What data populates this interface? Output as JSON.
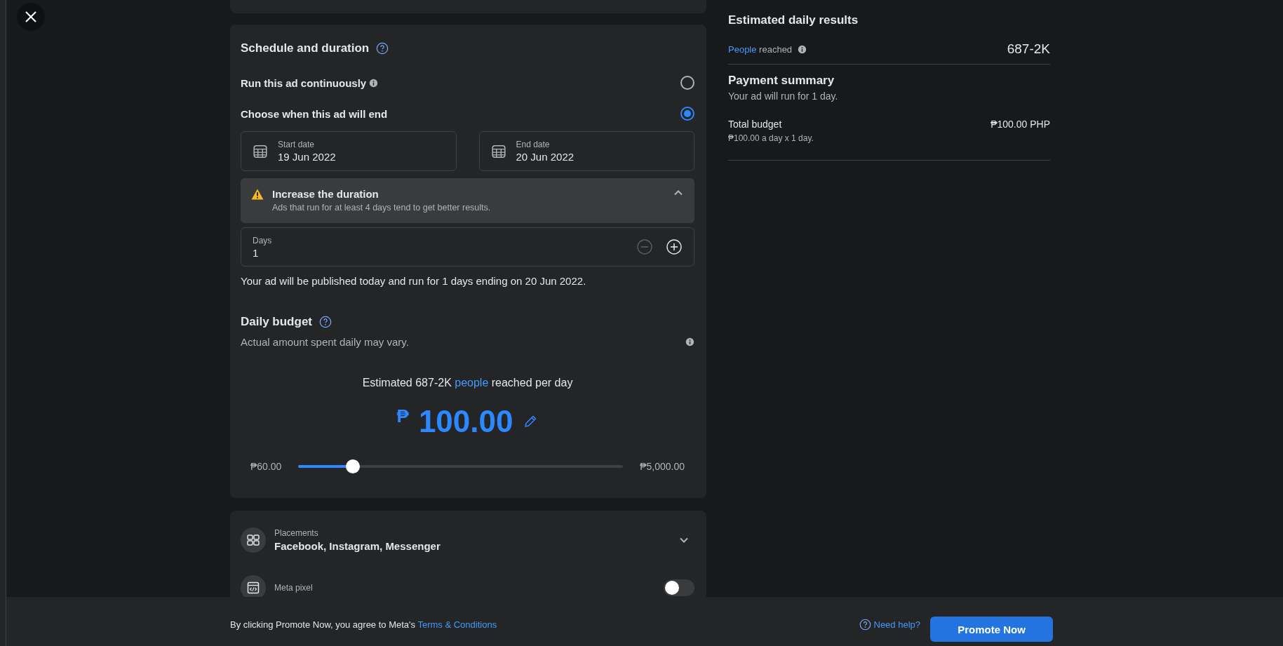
{
  "schedule": {
    "title": "Schedule and duration",
    "options": [
      {
        "label": "Run this ad continuously",
        "has_info": true,
        "selected": false
      },
      {
        "label": "Choose when this ad will end",
        "has_info": false,
        "selected": true
      }
    ],
    "dates": [
      {
        "label": "Start date",
        "value": "19 Jun 2022"
      },
      {
        "label": "End date",
        "value": "20 Jun 2022"
      }
    ],
    "notice": {
      "title": "Increase the duration",
      "text": "Ads that run for at least 4 days tend to get better results.",
      "expanded": true
    },
    "days_field": {
      "label": "Days",
      "value": "1",
      "steppers": [
        {
          "kind": "decrease",
          "disabled": true
        },
        {
          "kind": "increase",
          "disabled": false
        }
      ]
    },
    "summary": "Your ad will be published today and run for 1 days ending on 20 Jun 2022."
  },
  "budget": {
    "title": "Daily budget",
    "subtitle": "Actual amount spent daily may vary.",
    "estimate_before": "Estimated 687-2K ",
    "estimate_link": "people",
    "estimate_after": " reached per day",
    "currency": "₱",
    "amount": "100.00",
    "slider": {
      "min_label": "₱60.00",
      "max_label": "₱5,000.00",
      "level": 0.15
    }
  },
  "settings": [
    {
      "kind": "select",
      "label": "Placements",
      "value": "Facebook, Instagram, Messenger"
    },
    {
      "kind": "toggle",
      "label": "Meta pixel",
      "on": false
    }
  ],
  "results": {
    "title": "Estimated daily results",
    "metric_link": "People",
    "metric_label": "reached",
    "metric_value": "687-2K"
  },
  "payment": {
    "title": "Payment summary",
    "subtitle": "Your ad will run for 1 day.",
    "total_label": "Total budget",
    "total_detail": "₱100.00 a day x 1 day.",
    "total_value": "₱100.00 PHP"
  },
  "footer": {
    "agreement": "By clicking Promote Now, you agree to Meta's",
    "terms_link": "Terms & Conditions",
    "help_link": "Need help?",
    "primary_button": "Promote Now"
  }
}
